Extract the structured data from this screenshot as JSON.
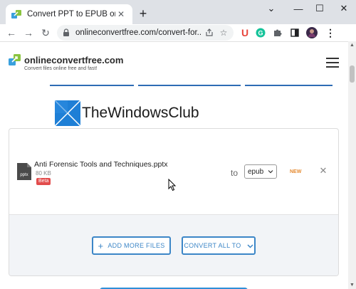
{
  "browser": {
    "tab": {
      "title": "Convert PPT to EPUB online, free",
      "close_glyph": "✕"
    },
    "new_tab_glyph": "+",
    "window_controls": {
      "chevron": "⌄",
      "minimize": "—",
      "maximize": "☐",
      "close": "✕"
    },
    "nav": {
      "back": "←",
      "forward": "→",
      "reload": "↻"
    },
    "address": {
      "url": "onlineconvertfree.com/convert-for..."
    },
    "extensions": [
      {
        "name": "ublock-extension",
        "glyph": "U",
        "color": "#e8453c"
      },
      {
        "name": "grammarly-extension",
        "glyph": "G",
        "color": "#15c39a"
      }
    ]
  },
  "site": {
    "name": "onlineconvertfree.com",
    "tagline": "Convert files online free and fast!"
  },
  "watermark": {
    "text": "TheWindowsClub"
  },
  "file": {
    "name": "Anti Forensic Tools and Techniques.pptx",
    "size": "80 KB",
    "badge": "Beta",
    "type_label": "pptx",
    "to_label": "to",
    "format": "epub",
    "new_label": "NEW",
    "remove_glyph": "✕"
  },
  "actions": {
    "add_more": "ADD MORE FILES",
    "add_glyph": "+",
    "convert_all": "CONVERT ALL TO"
  },
  "colors": {
    "accent": "#3c86c7",
    "badge_red": "#e24c4c",
    "new_orange": "#e58a2f"
  }
}
